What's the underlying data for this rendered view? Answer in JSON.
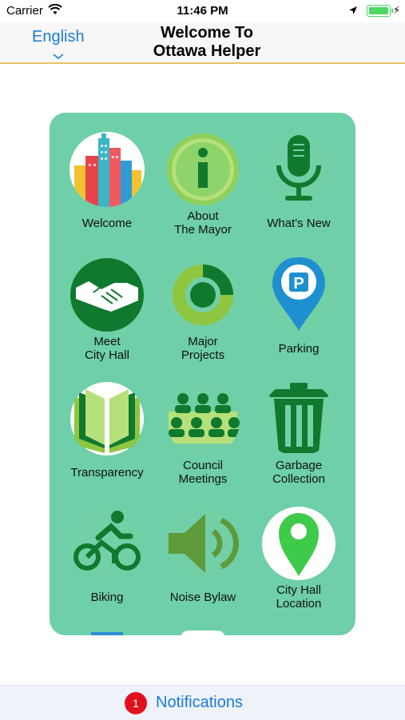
{
  "status": {
    "carrier": "Carrier",
    "time": "11:46 PM"
  },
  "nav": {
    "language": "English",
    "title_line1": "Welcome To",
    "title_line2": "Ottawa Helper"
  },
  "grid": [
    {
      "id": "welcome",
      "line1": "Welcome",
      "line2": ""
    },
    {
      "id": "about-mayor",
      "line1": "About",
      "line2": "The Mayor"
    },
    {
      "id": "whats-new",
      "line1": "What's New",
      "line2": ""
    },
    {
      "id": "meet-city-hall",
      "line1": "Meet",
      "line2": "City Hall"
    },
    {
      "id": "major-projects",
      "line1": "Major",
      "line2": "Projects"
    },
    {
      "id": "parking",
      "line1": "Parking",
      "line2": ""
    },
    {
      "id": "transparency",
      "line1": "Transparency",
      "line2": ""
    },
    {
      "id": "council-meetings",
      "line1": "Council",
      "line2": "Meetings"
    },
    {
      "id": "garbage-collection",
      "line1": "Garbage",
      "line2": "Collection"
    },
    {
      "id": "biking",
      "line1": "Biking",
      "line2": ""
    },
    {
      "id": "noise-bylaw",
      "line1": "Noise Bylaw",
      "line2": ""
    },
    {
      "id": "city-hall-location",
      "line1": "City Hall",
      "line2": "Location"
    }
  ],
  "parking_letter": "P",
  "bottom": {
    "badge_count": "1",
    "notifications_label": "Notifications"
  },
  "colors": {
    "panel": "#6ecfa8",
    "accent_blue": "#1a7bd6",
    "green_dark": "#0f7a2e",
    "badge_red": "#e0121e"
  }
}
